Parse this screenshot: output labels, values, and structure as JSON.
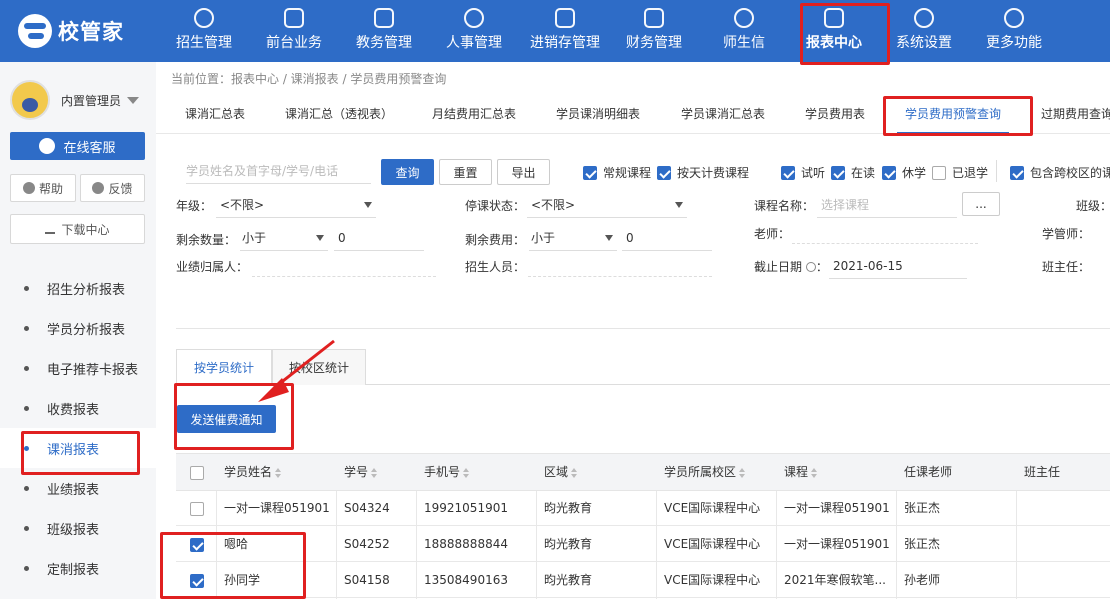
{
  "app": {
    "logo_text": "校管家",
    "brand_color": "#2e6cc7"
  },
  "nav": [
    {
      "label": "招生管理",
      "icon": "person-add-icon"
    },
    {
      "label": "前台业务",
      "icon": "desk-icon"
    },
    {
      "label": "教务管理",
      "icon": "book-icon"
    },
    {
      "label": "人事管理",
      "icon": "person-icon"
    },
    {
      "label": "进销存管理",
      "icon": "inventory-icon"
    },
    {
      "label": "财务管理",
      "icon": "yuan-icon"
    },
    {
      "label": "师生信",
      "icon": "chat-icon"
    },
    {
      "label": "报表中心",
      "icon": "chart-icon",
      "active": true
    },
    {
      "label": "系统设置",
      "icon": "gear-icon"
    },
    {
      "label": "更多功能",
      "icon": "more-icon"
    }
  ],
  "sidebar": {
    "user_name": "内置管理员",
    "support_label": "在线客服",
    "help_label": "帮助",
    "feedback_label": "反馈",
    "download_label": "下载中心",
    "items": [
      {
        "label": "招生分析报表"
      },
      {
        "label": "学员分析报表"
      },
      {
        "label": "电子推荐卡报表"
      },
      {
        "label": "收费报表"
      },
      {
        "label": "课消报表",
        "active": true
      },
      {
        "label": "业绩报表"
      },
      {
        "label": "班级报表"
      },
      {
        "label": "定制报表"
      }
    ]
  },
  "breadcrumb": "当前位置：报表中心 / 课消报表 / 学员费用预警查询",
  "tabs": [
    {
      "label": "课消汇总表"
    },
    {
      "label": "课消汇总（透视表）"
    },
    {
      "label": "月结费用汇总表"
    },
    {
      "label": "学员课消明细表"
    },
    {
      "label": "学员课消汇总表"
    },
    {
      "label": "学员费用表"
    },
    {
      "label": "学员费用预警查询",
      "active": true
    },
    {
      "label": "过期费用查询"
    }
  ],
  "filters": {
    "search_placeholder": "学员姓名及首字母/学号/电话",
    "query_button": "查询",
    "reset_button": "重置",
    "export_button": "导出",
    "checkboxes": [
      {
        "label": "常规课程",
        "checked": true
      },
      {
        "label": "按天计费课程",
        "checked": true
      },
      {
        "label": "试听",
        "checked": true
      },
      {
        "label": "在读",
        "checked": true
      },
      {
        "label": "休学",
        "checked": true
      },
      {
        "label": "已退学",
        "checked": false
      },
      {
        "label": "包含跨校区的课",
        "checked": true
      }
    ],
    "grade_label": "年级：",
    "grade_value": "<不限>",
    "suspend_label": "停课状态：",
    "suspend_value": "<不限>",
    "course_label": "课程名称：",
    "course_placeholder": "选择课程",
    "course_picker": "...",
    "class_label": "班级：",
    "remain_qty_label": "剩余数量：",
    "remain_qty_op": "小于",
    "remain_qty_value": "0",
    "remain_fee_label": "剩余费用：",
    "remain_fee_op": "小于",
    "remain_fee_value": "0",
    "teacher_label": "老师：",
    "manager_label": "学管师：",
    "owner_label": "业绩归属人：",
    "recruiter_label": "招生人员：",
    "deadline_label": "截止日期",
    "deadline_value": "2021-06-15",
    "head_teacher_label": "班主任："
  },
  "subtabs": [
    {
      "label": "按学员统计",
      "active": true
    },
    {
      "label": "按校区统计"
    }
  ],
  "send_notice_button": "发送催费通知",
  "table": {
    "headers": [
      "学员姓名",
      "学号",
      "手机号",
      "区域",
      "学员所属校区",
      "课程",
      "任课老师",
      "班主任"
    ],
    "rows": [
      {
        "checked": false,
        "cells": [
          "一对一课程051901",
          "S04324",
          "19921051901",
          "昀光教育",
          "VCE国际课程中心",
          "一对一课程051901",
          "张正杰",
          ""
        ]
      },
      {
        "checked": true,
        "cells": [
          "嗯哈",
          "S04252",
          "18888888844",
          "昀光教育",
          "VCE国际课程中心",
          "一对一课程051901",
          "张正杰",
          ""
        ]
      },
      {
        "checked": true,
        "cells": [
          "孙同学",
          "S04158",
          "13508490163",
          "昀光教育",
          "VCE国际课程中心",
          "2021年寒假软笔...",
          "孙老师",
          ""
        ]
      }
    ]
  }
}
